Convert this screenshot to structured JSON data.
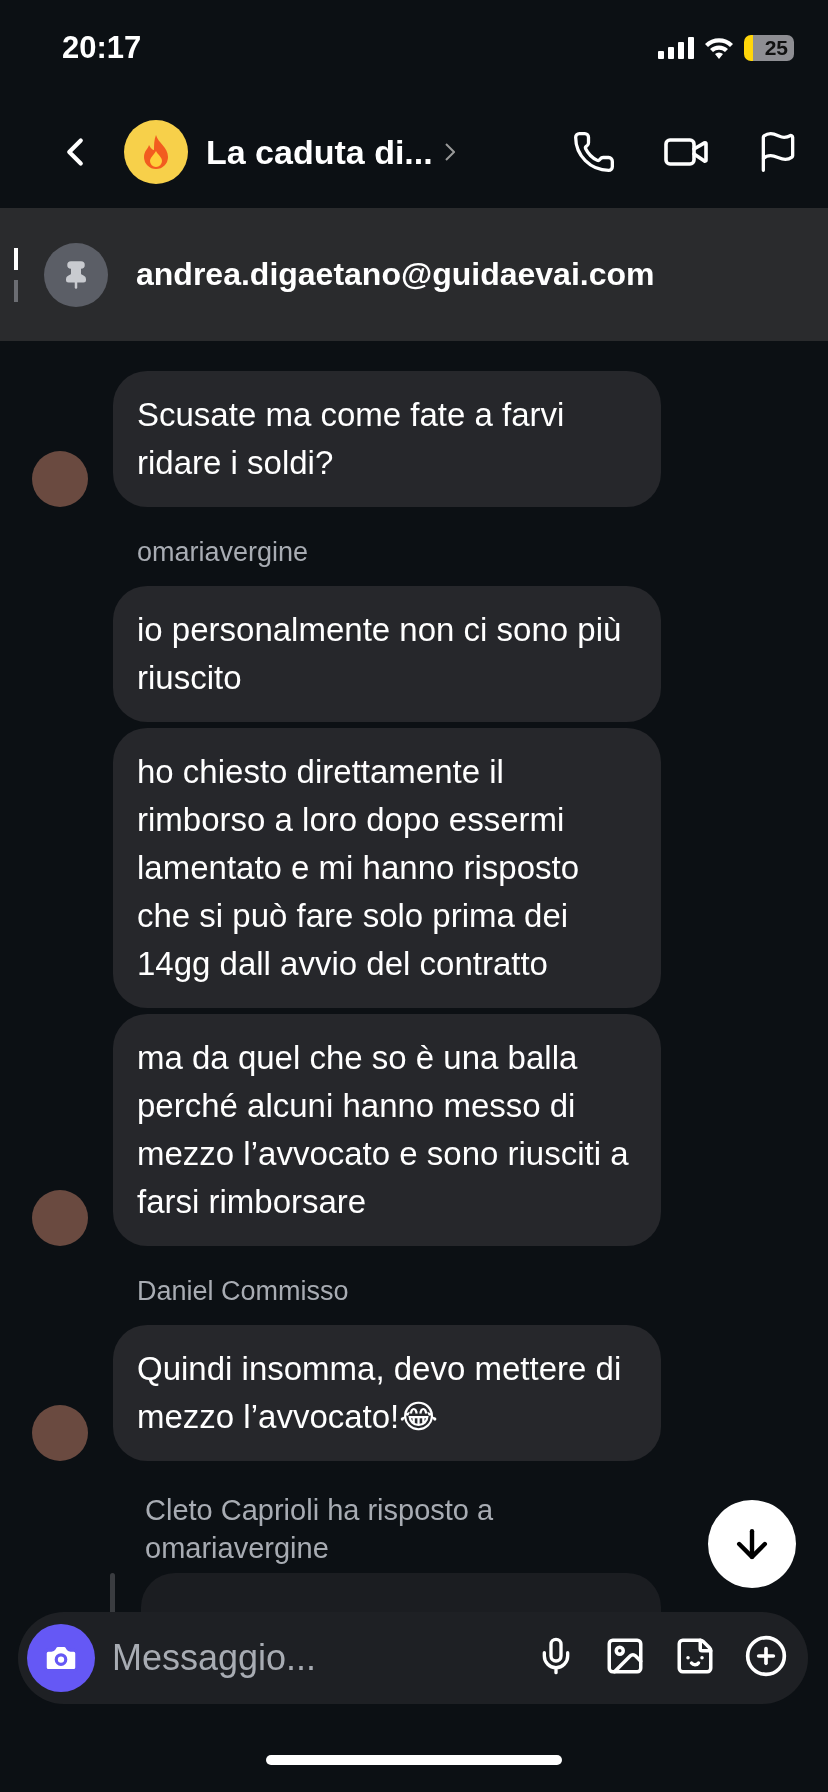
{
  "status_bar": {
    "time": "20:17",
    "battery": "25"
  },
  "header": {
    "title": "La caduta di..."
  },
  "pinned": {
    "text": "andrea.digaetano@guidaevai.com"
  },
  "groups": [
    {
      "messages": [
        "Scusate ma come fate a farvi ridare i soldi?"
      ]
    },
    {
      "sender": "omariavergine",
      "messages": [
        "io personalmente non ci sono più riuscito",
        "ho chiesto direttamente il rimborso a loro dopo essermi lamentato e mi hanno risposto che si può fare solo prima dei 14gg dall avvio del contratto",
        "ma da quel che so è una balla perché alcuni hanno messo di mezzo l’avvocato e sono riusciti a farsi rimborsare"
      ]
    },
    {
      "sender": "Daniel Commisso",
      "messages": [
        "Quindi insomma, devo mettere di mezzo l’avvocato!😂"
      ]
    }
  ],
  "reply": {
    "caption": "Cleto Caprioli ha risposto a omariavergine"
  },
  "composer": {
    "placeholder": "Messaggio..."
  }
}
